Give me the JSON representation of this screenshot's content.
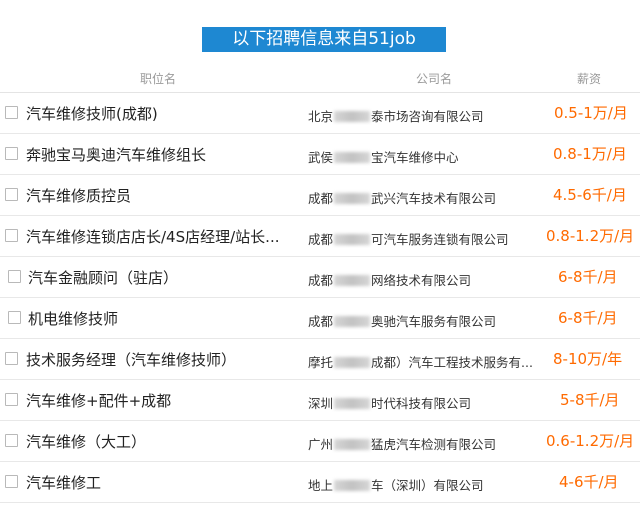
{
  "banner": "以下招聘信息来自51job",
  "header": {
    "title": "职位名",
    "company": "公司名",
    "salary": "薪资"
  },
  "jobs": [
    {
      "title": "汽车维修技师(成都)",
      "company_start": "北京",
      "company_end": "泰市场咨询有限公司",
      "salary": "0.5-1万/月"
    },
    {
      "title": "奔驰宝马奥迪汽车维修组长",
      "company_start": "武侯",
      "company_end": "宝汽车维修中心",
      "salary": "0.8-1万/月"
    },
    {
      "title": "汽车维修质控员",
      "company_start": "成都",
      "company_end": "武兴汽车技术有限公司",
      "salary": "4.5-6千/月"
    },
    {
      "title": "汽车维修连锁店店长/4S店经理/站长...",
      "company_start": "成都",
      "company_end": "可汽车服务连锁有限公司",
      "salary": "0.8-1.2万/月"
    },
    {
      "title": "汽车金融顾问（驻店）",
      "company_start": "成都",
      "company_end": "网络技术有限公司",
      "salary": "6-8千/月"
    },
    {
      "title": "机电维修技师",
      "company_start": "成都",
      "company_end": "奥驰汽车服务有限公司",
      "salary": "6-8千/月"
    },
    {
      "title": "技术服务经理（汽车维修技师）",
      "company_start": "摩托",
      "company_end": "成都）汽车工程技术服务有...",
      "salary": "8-10万/年"
    },
    {
      "title": "汽车维修+配件+成都",
      "company_start": "深圳",
      "company_end": "时代科技有限公司",
      "salary": "5-8千/月"
    },
    {
      "title": "汽车维修（大工）",
      "company_start": "广州",
      "company_end": "猛虎汽车检测有限公司",
      "salary": "0.6-1.2万/月"
    },
    {
      "title": "汽车维修工",
      "company_start": "地上",
      "company_end": "车（深圳）有限公司",
      "salary": "4-6千/月"
    }
  ]
}
